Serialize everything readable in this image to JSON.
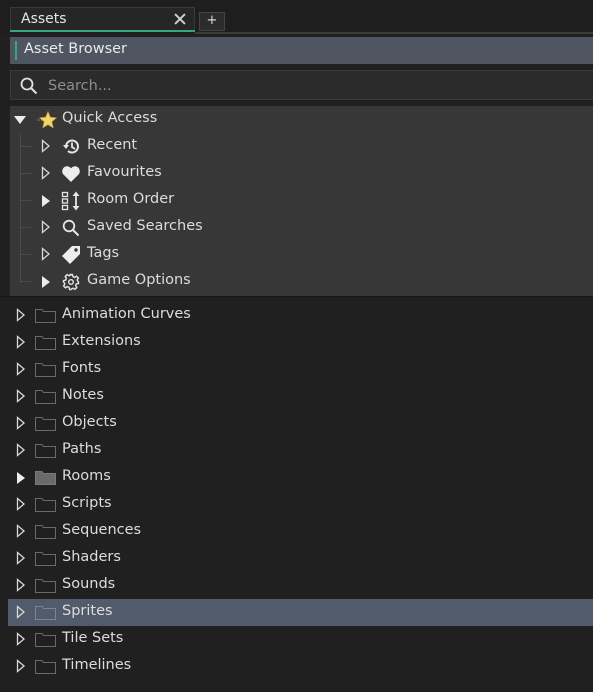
{
  "tabs": {
    "active_label": "Assets",
    "add_label": "+"
  },
  "header": {
    "title": "Asset Browser"
  },
  "search": {
    "placeholder": "Search..."
  },
  "quick_access": {
    "label": "Quick Access",
    "items": [
      {
        "label": "Recent",
        "icon": "history-icon",
        "expanded": false
      },
      {
        "label": "Favourites",
        "icon": "heart-icon",
        "expanded": false
      },
      {
        "label": "Room Order",
        "icon": "room-order-icon",
        "expanded": false
      },
      {
        "label": "Saved Searches",
        "icon": "search-icon",
        "expanded": false
      },
      {
        "label": "Tags",
        "icon": "tag-icon",
        "expanded": false
      },
      {
        "label": "Game Options",
        "icon": "gear-icon",
        "expanded": false
      }
    ]
  },
  "assets": [
    {
      "label": "Animation Curves"
    },
    {
      "label": "Extensions"
    },
    {
      "label": "Fonts"
    },
    {
      "label": "Notes"
    },
    {
      "label": "Objects"
    },
    {
      "label": "Paths"
    },
    {
      "label": "Rooms"
    },
    {
      "label": "Scripts"
    },
    {
      "label": "Sequences"
    },
    {
      "label": "Shaders"
    },
    {
      "label": "Sounds"
    },
    {
      "label": "Sprites"
    },
    {
      "label": "Tile Sets"
    },
    {
      "label": "Timelines"
    }
  ],
  "selected_asset": "Sprites",
  "colors": {
    "accent": "#3aa57a",
    "selection": "#525b6b",
    "header": "#4f5561",
    "background": "#202020"
  }
}
